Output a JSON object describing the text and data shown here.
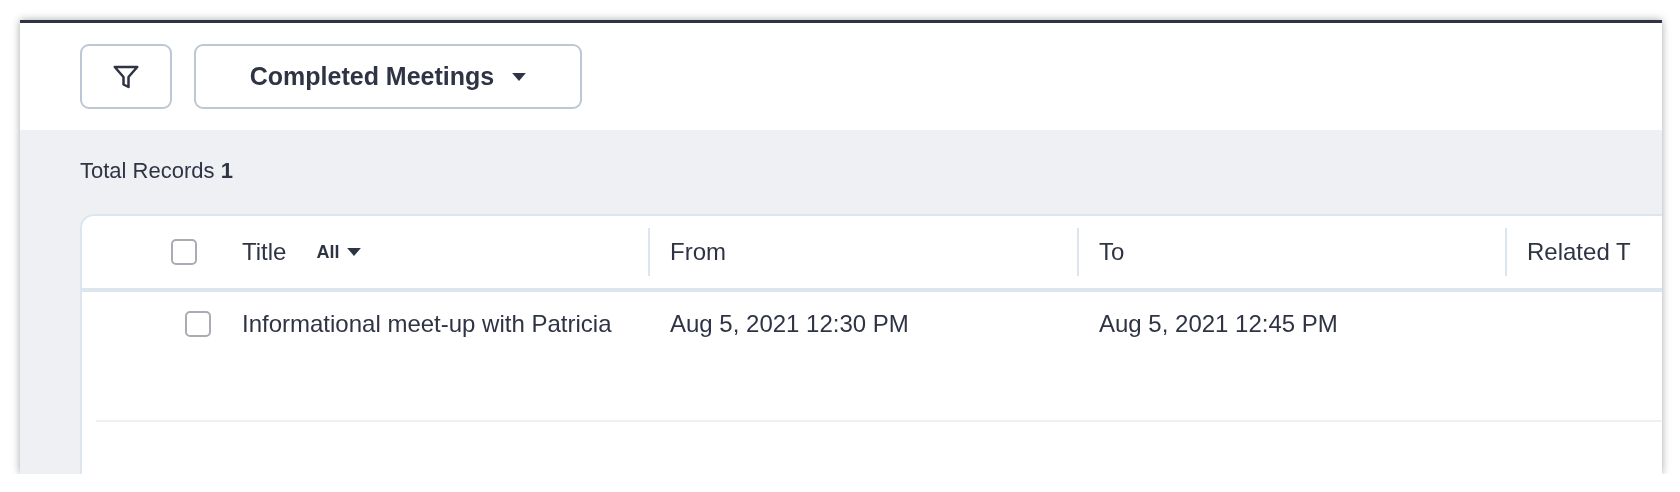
{
  "toolbar": {
    "view_selector": {
      "label": "Completed Meetings"
    }
  },
  "summary": {
    "text": "Total Records **1**"
  },
  "table": {
    "select_all": {
      "checked": false
    },
    "columns": [
      {
        "label": "Title",
        "filter": "All"
      },
      {
        "label": "From"
      },
      {
        "label": "To"
      },
      {
        "label": "Related T"
      }
    ],
    "rows": [
      {
        "checked": false,
        "cells": [
          "Informational meet-up with Patricia",
          "Aug 5, 2021 12:30 PM",
          "Aug 5, 2021 12:45 PM",
          ""
        ]
      }
    ]
  }
}
